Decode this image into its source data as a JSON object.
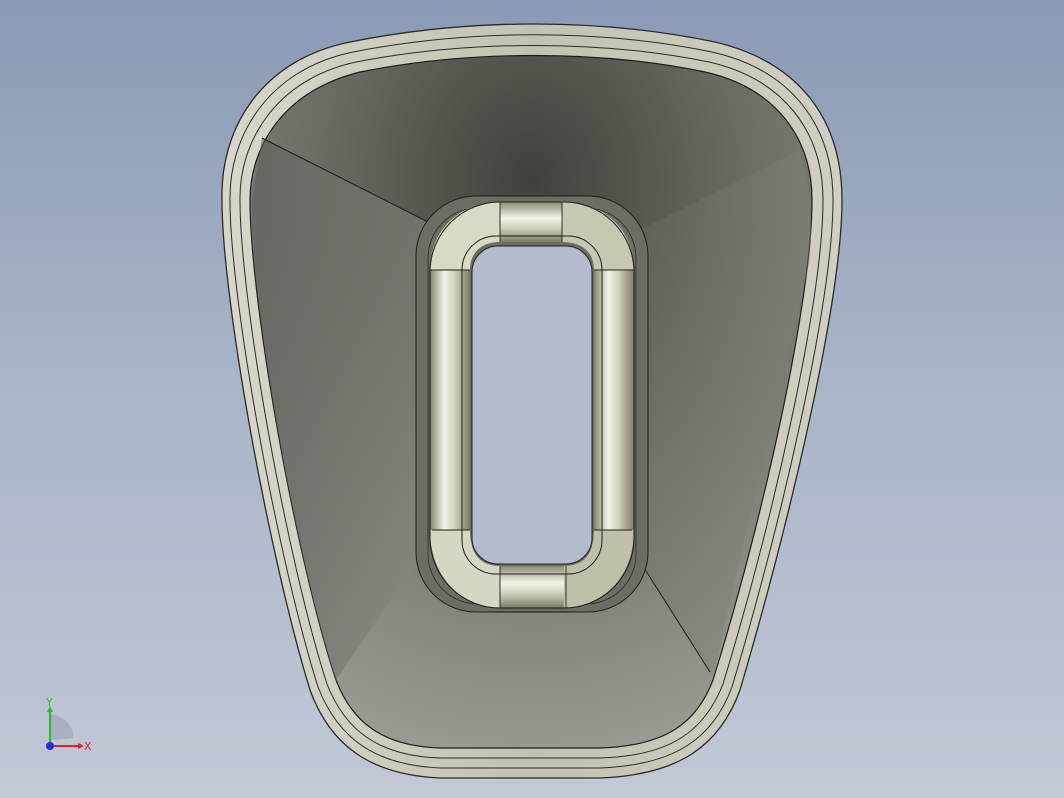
{
  "viewport": {
    "background_top": "#8a9ab5",
    "background_bottom": "#c2c8d6"
  },
  "model": {
    "part_color": "#c9c8b8",
    "inner_wall_dark": "#4a4c44",
    "inner_wall_light": "#8a8a80",
    "edge_color": "#1e1e1e"
  },
  "triad": {
    "x_label": "X",
    "y_label": "Y",
    "x_color": "#e02020",
    "y_color": "#20c020",
    "z_color": "#2030e0"
  }
}
